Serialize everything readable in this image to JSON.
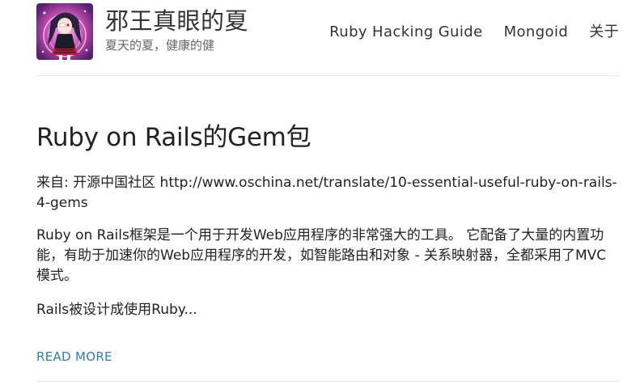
{
  "site": {
    "title": "邪王真眼的夏",
    "tagline": "夏天的夏，健康的健",
    "avatar_icon": "anime-girl-avatar-icon"
  },
  "nav": {
    "items": [
      {
        "label": "Ruby Hacking Guide"
      },
      {
        "label": "Mongoid"
      },
      {
        "label": "关于"
      }
    ]
  },
  "post": {
    "title": "Ruby on Rails的Gem包",
    "source_prefix": "来自: 开源中国社区 ",
    "source_url": "http://www.oschina.net/translate/10-essential-useful-ruby-on-rails-4-gems",
    "paragraph1": "Ruby on Rails框架是一个用于开发Web应用程序的非常强大的工具。 它配备了大量的内置功能，有助于加速你的Web应用程序的开发，如智能路由和对象 - 关系映射器，全都采用了MVC模式。",
    "paragraph2": "Rails被设计成使用Ruby...",
    "read_more": "READ MORE"
  },
  "colors": {
    "link": "#2e7bc4",
    "text": "#222222",
    "divider": "#e6e6e6"
  }
}
